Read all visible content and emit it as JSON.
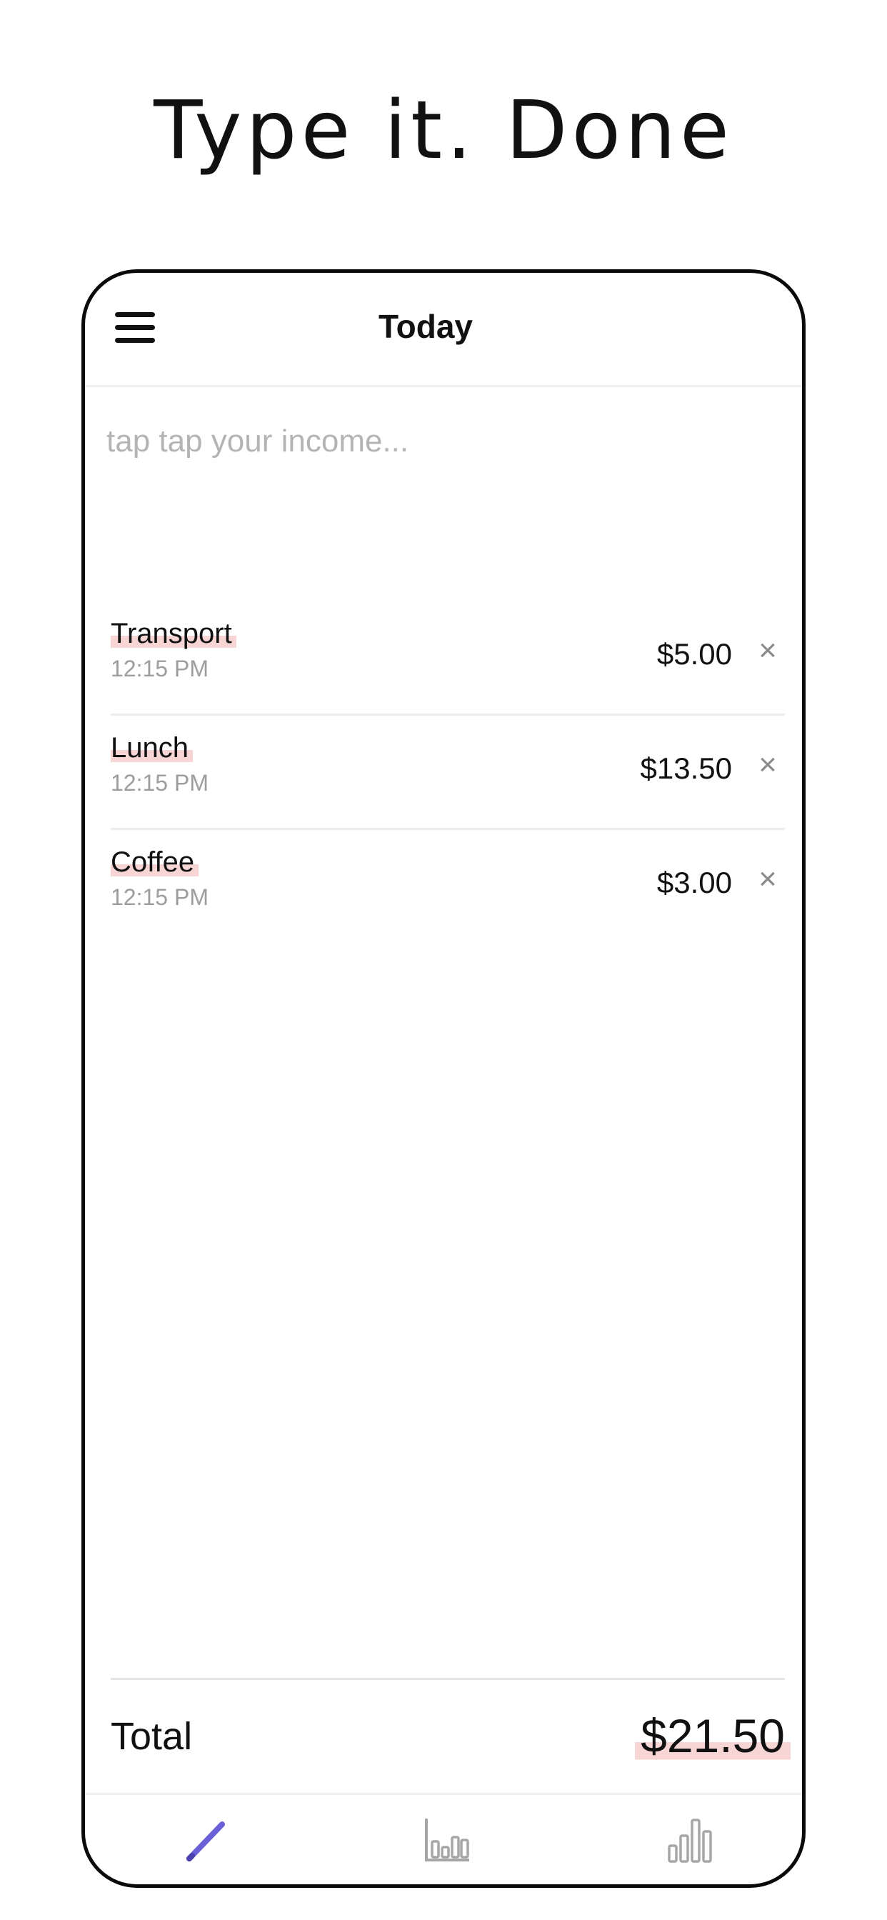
{
  "headline": "Type it.  Done",
  "appbar": {
    "title": "Today"
  },
  "entry": {
    "placeholder": "tap tap your income..."
  },
  "items": [
    {
      "name": "Transport",
      "time": "12:15 PM",
      "amount": "$5.00",
      "remove": "×"
    },
    {
      "name": "Lunch",
      "time": "12:15 PM",
      "amount": "$13.50",
      "remove": "×"
    },
    {
      "name": "Coffee",
      "time": "12:15 PM",
      "amount": "$3.00",
      "remove": "×"
    }
  ],
  "total": {
    "label": "Total",
    "amount": "$21.50"
  },
  "tabs": [
    {
      "icon": "pencil-icon",
      "active": true
    },
    {
      "icon": "bar-chart-outline-icon",
      "active": false
    },
    {
      "icon": "bar-chart-icon",
      "active": false
    }
  ],
  "colors": {
    "accent": "#6a5fd6",
    "highlight": "#f8d5d5",
    "inactive_icon": "#a6a6a6"
  }
}
